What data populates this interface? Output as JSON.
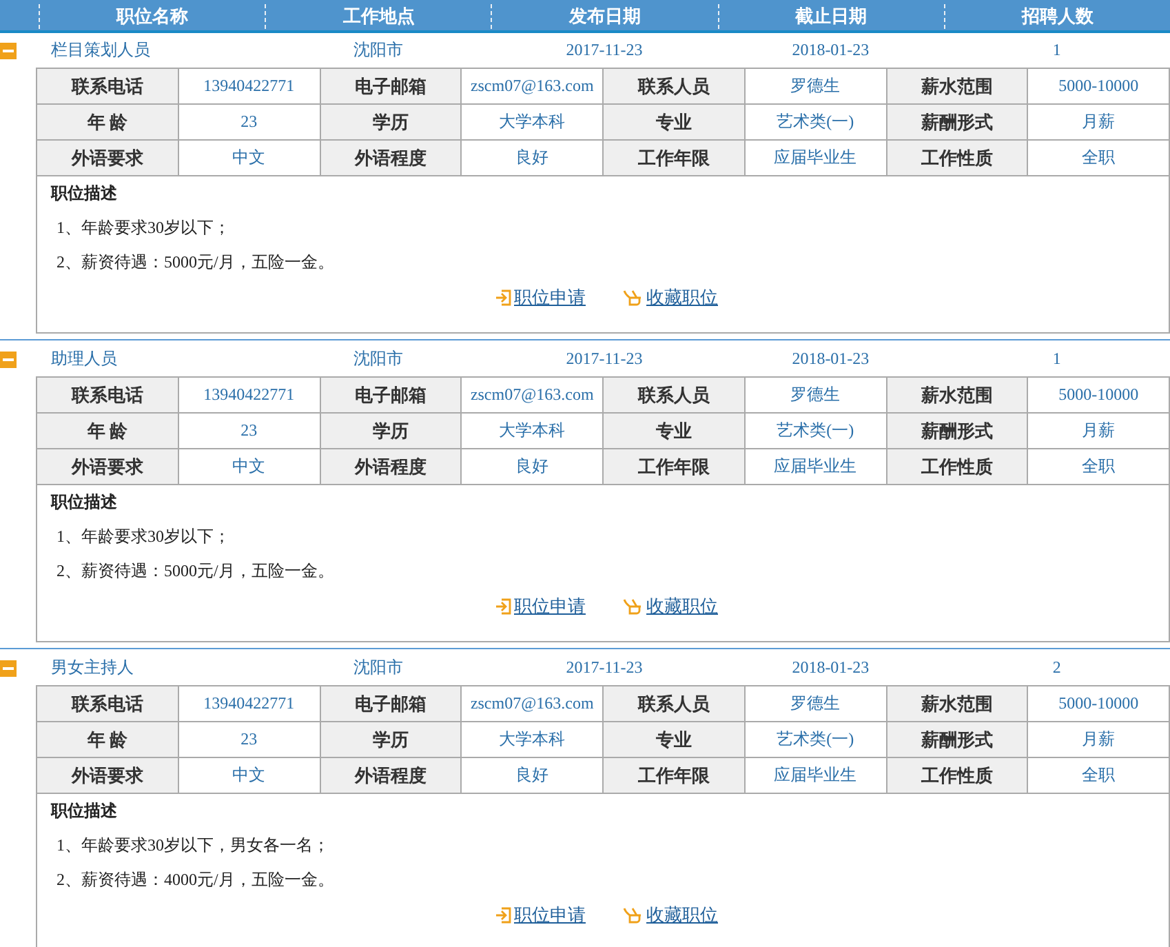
{
  "header": {
    "columns": [
      "职位名称",
      "工作地点",
      "发布日期",
      "截止日期",
      "招聘人数"
    ]
  },
  "jobs": [
    {
      "expanded": true,
      "title": "栏目策划人员",
      "location": "沈阳市",
      "publish_date": "2017-11-23",
      "deadline": "2018-01-23",
      "headcount": "1",
      "details": [
        {
          "label": "联系电话",
          "value": "13940422771"
        },
        {
          "label": "电子邮箱",
          "value": "zscm07@163.com"
        },
        {
          "label": "联系人员",
          "value": "罗德生"
        },
        {
          "label": "薪水范围",
          "value": "5000-10000"
        },
        {
          "label": "年 龄",
          "value": "23"
        },
        {
          "label": "学历",
          "value": "大学本科"
        },
        {
          "label": "专业",
          "value": "艺术类(一)"
        },
        {
          "label": "薪酬形式",
          "value": "月薪"
        },
        {
          "label": "外语要求",
          "value": "中文"
        },
        {
          "label": "外语程度",
          "value": "良好"
        },
        {
          "label": "工作年限",
          "value": "应届毕业生"
        },
        {
          "label": "工作性质",
          "value": "全职"
        }
      ],
      "description": {
        "heading": "职位描述",
        "lines": [
          "1、年龄要求30岁以下；",
          "2、薪资待遇：5000元/月，五险一金。"
        ]
      },
      "actions": [
        {
          "kind": "apply",
          "label": "职位申请"
        },
        {
          "kind": "favorite",
          "label": "收藏职位"
        }
      ]
    },
    {
      "expanded": true,
      "title": "助理人员",
      "location": "沈阳市",
      "publish_date": "2017-11-23",
      "deadline": "2018-01-23",
      "headcount": "1",
      "details": [
        {
          "label": "联系电话",
          "value": "13940422771"
        },
        {
          "label": "电子邮箱",
          "value": "zscm07@163.com"
        },
        {
          "label": "联系人员",
          "value": "罗德生"
        },
        {
          "label": "薪水范围",
          "value": "5000-10000"
        },
        {
          "label": "年 龄",
          "value": "23"
        },
        {
          "label": "学历",
          "value": "大学本科"
        },
        {
          "label": "专业",
          "value": "艺术类(一)"
        },
        {
          "label": "薪酬形式",
          "value": "月薪"
        },
        {
          "label": "外语要求",
          "value": "中文"
        },
        {
          "label": "外语程度",
          "value": "良好"
        },
        {
          "label": "工作年限",
          "value": "应届毕业生"
        },
        {
          "label": "工作性质",
          "value": "全职"
        }
      ],
      "description": {
        "heading": "职位描述",
        "lines": [
          "1、年龄要求30岁以下；",
          "2、薪资待遇：5000元/月，五险一金。"
        ]
      },
      "actions": [
        {
          "kind": "apply",
          "label": "职位申请"
        },
        {
          "kind": "favorite",
          "label": "收藏职位"
        }
      ]
    },
    {
      "expanded": true,
      "title": "男女主持人",
      "location": "沈阳市",
      "publish_date": "2017-11-23",
      "deadline": "2018-01-23",
      "headcount": "2",
      "details": [
        {
          "label": "联系电话",
          "value": "13940422771"
        },
        {
          "label": "电子邮箱",
          "value": "zscm07@163.com"
        },
        {
          "label": "联系人员",
          "value": "罗德生"
        },
        {
          "label": "薪水范围",
          "value": "5000-10000"
        },
        {
          "label": "年 龄",
          "value": "23"
        },
        {
          "label": "学历",
          "value": "大学本科"
        },
        {
          "label": "专业",
          "value": "艺术类(一)"
        },
        {
          "label": "薪酬形式",
          "value": "月薪"
        },
        {
          "label": "外语要求",
          "value": "中文"
        },
        {
          "label": "外语程度",
          "value": "良好"
        },
        {
          "label": "工作年限",
          "value": "应届毕业生"
        },
        {
          "label": "工作性质",
          "value": "全职"
        }
      ],
      "description": {
        "heading": "职位描述",
        "lines": [
          "1、年龄要求30岁以下，男女各一名；",
          "2、薪资待遇：4000元/月，五险一金。"
        ]
      },
      "actions": [
        {
          "kind": "apply",
          "label": "职位申请"
        },
        {
          "kind": "favorite",
          "label": "收藏职位"
        }
      ]
    }
  ]
}
